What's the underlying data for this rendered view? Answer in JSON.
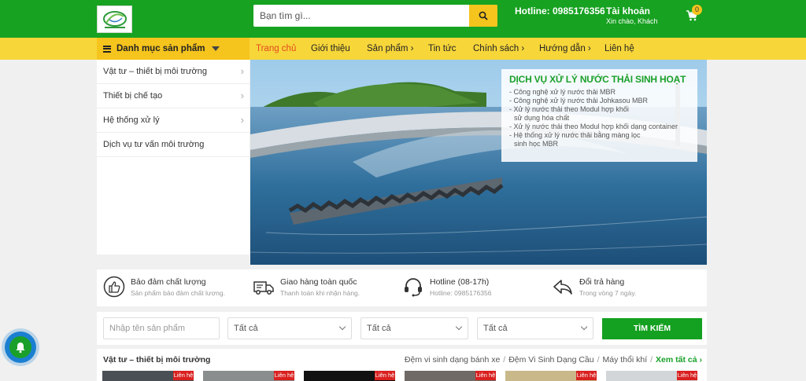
{
  "header": {
    "search_placeholder": "Bạn tìm gì...",
    "hotline": "Hotline: 0985176356",
    "account_label": "Tài khoản",
    "greeting": "Xin chào, Khách",
    "cart_count": "0"
  },
  "nav": {
    "category_title": "Danh mục sản phẩm",
    "items": [
      "Trang chủ",
      "Giới thiệu",
      "Sản phẩm ›",
      "Tin tức",
      "Chính sách ›",
      "Hướng dẫn ›",
      "Liên hệ"
    ]
  },
  "sidebar": {
    "items": [
      "Vật tư – thiết bị môi trường",
      "Thiết bị chế tạo",
      "Hệ thống xử lý",
      "Dịch vụ tư vấn môi trường"
    ]
  },
  "banner": {
    "title": "DỊCH VỤ XỬ LÝ NƯỚC THẢI SINH HOẠT",
    "lines": [
      "- Công nghệ xử lý nước thải MBR",
      "- Công nghệ xử lý nước thải Johkasou MBR",
      "- Xử lý nước thải theo Modul hợp khối",
      "  sử dụng hóa chất",
      "- Xử lý nước thải theo Modul hợp khối dạng container",
      "- Hệ thống xử lý nước thải bằng màng lọc",
      "  sinh học MBR"
    ]
  },
  "features": [
    {
      "title": "Bảo đảm chất lượng",
      "sub": "Sản phẩm bảo đảm chất lượng.",
      "icon": "thumbs-up-icon"
    },
    {
      "title": "Giao hàng toàn quốc",
      "sub": "Thanh toán khi nhận hàng.",
      "icon": "truck-icon"
    },
    {
      "title": "Hotline (08-17h)",
      "sub": "Hotline: 0985176356",
      "icon": "headset-icon"
    },
    {
      "title": "Đổi trả hàng",
      "sub": "Trong vòng 7 ngày.",
      "icon": "return-arrow-icon"
    }
  ],
  "filter": {
    "name_placeholder": "Nhập tên sản phẩm",
    "select1": "Tất cả",
    "select2": "Tất cả",
    "select3": "Tất cả",
    "button": "TÌM KIẾM"
  },
  "section": {
    "title": "Vật tư – thiết bị môi trường",
    "links": [
      "Đệm vi sinh dạng bánh xe",
      "Đệm Vi Sinh Dạng Cầu",
      "Máy thổi khí"
    ],
    "view_all": "Xem tất cả ›",
    "tag": "Liên hệ"
  },
  "colors": {
    "green": "#17a221",
    "yellow": "#f7d63a",
    "accent": "#f5c41d",
    "active_nav": "#e44a1f"
  }
}
